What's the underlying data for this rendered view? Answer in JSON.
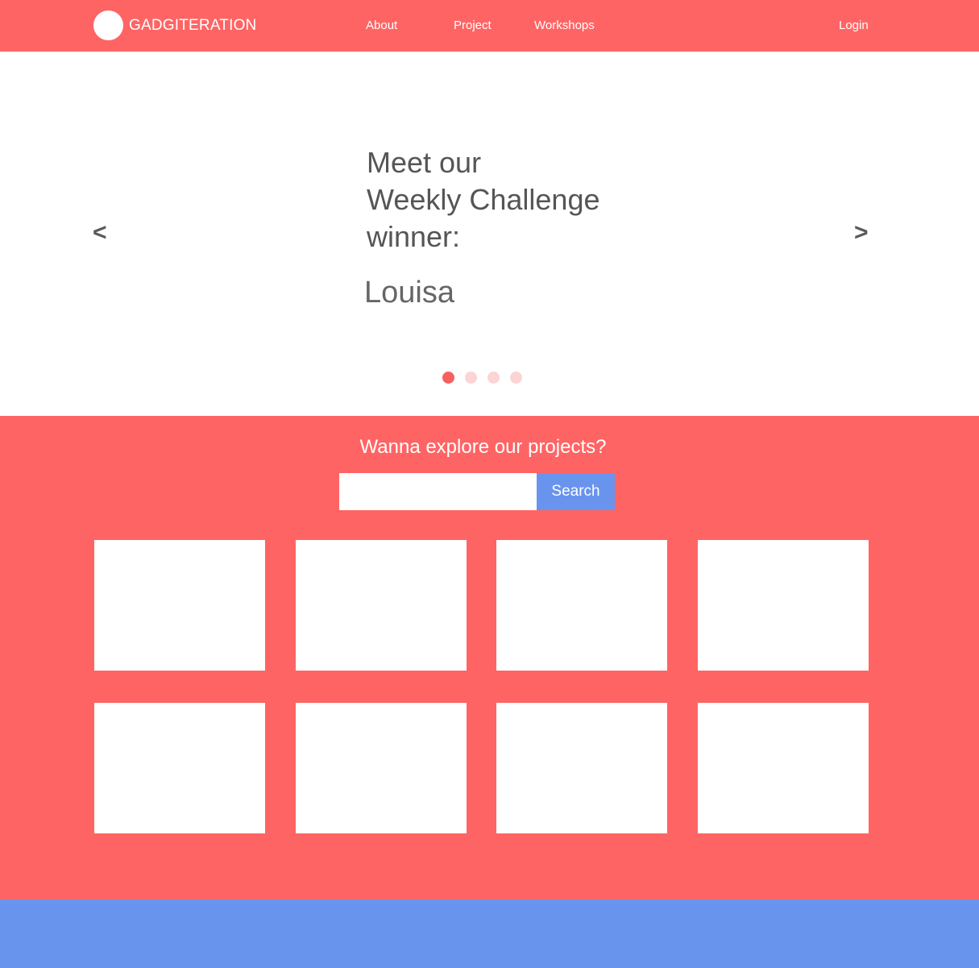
{
  "header": {
    "brand": "GADGITERATION",
    "nav": [
      "About",
      "Project",
      "Workshops"
    ],
    "login_label": "Login"
  },
  "hero": {
    "prev_label": "<",
    "next_label": ">",
    "lines": [
      "Meet our",
      "Weekly Challenge",
      "winner:"
    ],
    "winner_name": "Louisa",
    "slide_count": 4,
    "active_slide": 1
  },
  "explore": {
    "title": "Wanna explore our projects?",
    "search_value": "",
    "search_button_label": "Search",
    "project_tiles": 8
  },
  "colors": {
    "brand_red": "#ff6464",
    "accent_blue": "#6894ee",
    "dot_active": "#f76060",
    "dot_inactive": "#fcd4d4"
  },
  "icons": [
    "logo-circle-icon"
  ]
}
